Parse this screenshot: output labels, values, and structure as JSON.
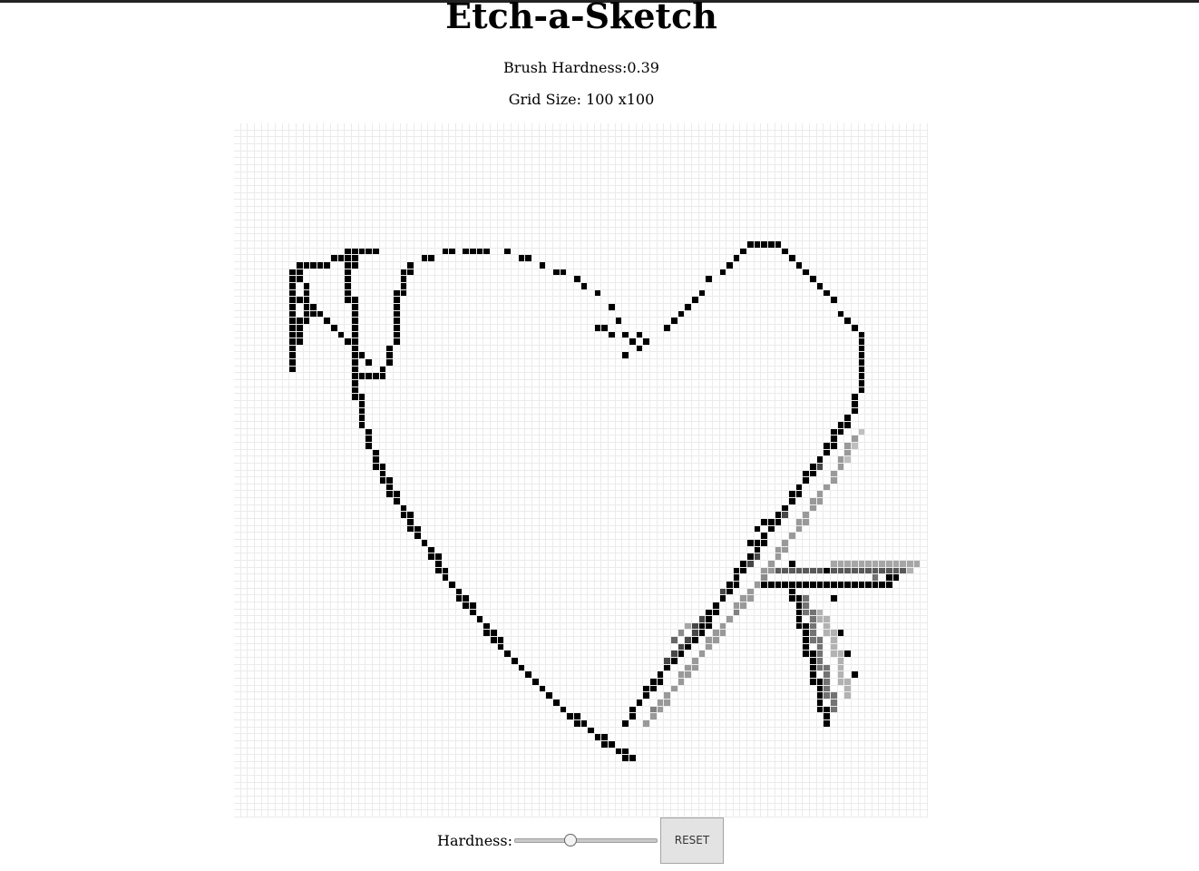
{
  "app": {
    "title": "Etch-a-Sketch",
    "hardness_text": "Brush Hardness:0.39",
    "grid_size_text": "Grid Size: 100 x100"
  },
  "grid": {
    "columns": 100,
    "rows": 100,
    "background_color": "#ffffff",
    "gridline_color": "#ebebeb",
    "ink_color": "#000000"
  },
  "controls": {
    "hardness_label": "Hardness:",
    "hardness_value": 0.39,
    "reset_label": "RESET"
  }
}
